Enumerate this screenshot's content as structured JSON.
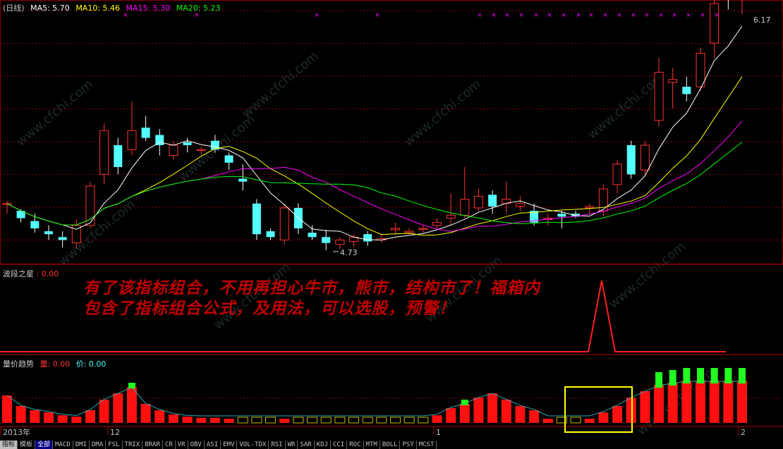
{
  "main_panel": {
    "period_label": "(日线)",
    "ma": [
      {
        "label": "MA5: 5.70",
        "color": "#ffffff"
      },
      {
        "label": "MA10: 5.46",
        "color": "#ffff00"
      },
      {
        "label": "MA15: 5.30",
        "color": "#ff00ff"
      },
      {
        "label": "MA20: 5.23",
        "color": "#00ff00"
      }
    ],
    "high_label": "6.17",
    "low_label": "4.73"
  },
  "indicator_panel": {
    "name": "波段之星",
    "value": ": 0.00",
    "promo_text": "有了该指标组合，不用再担心牛市，熊市，结构市了！福箱内包含了指标组合公式，及用法，可以选股，预警！"
  },
  "volume_panel": {
    "name": "量价趋势",
    "vol_label": "量: 0.00",
    "price_label": "价: 0.00"
  },
  "date_axis": {
    "labels": [
      "2013年",
      "12",
      "1",
      "2"
    ]
  },
  "tabs": [
    "指标",
    "模板",
    "全部",
    "MACD",
    "DMI",
    "DMA",
    "FSL",
    "TRIX",
    "BRAR",
    "CR",
    "VR",
    "OBV",
    "ASI",
    "EMV",
    "VOL-TDX",
    "RSI",
    "WR",
    "SAR",
    "KDJ",
    "CCI",
    "ROC",
    "MTM",
    "BOLL",
    "PSY",
    "MCST"
  ],
  "watermark": "www.cfchi.com",
  "colors": {
    "up": "#ff3232",
    "down": "#54ffff",
    "ma5": "#ffffff",
    "ma10": "#ffff00",
    "ma15": "#ff00ff",
    "ma20": "#00ff00",
    "grid": "#8b0000",
    "highlight": "#ffff00"
  },
  "chart_data": {
    "type": "candlestick",
    "ohlc": [
      [
        5.05,
        5.07,
        4.98,
        5.05
      ],
      [
        5.0,
        5.01,
        4.92,
        4.95
      ],
      [
        4.93,
        4.98,
        4.85,
        4.88
      ],
      [
        4.86,
        4.9,
        4.8,
        4.84
      ],
      [
        4.82,
        4.86,
        4.75,
        4.8
      ],
      [
        4.78,
        4.94,
        4.74,
        4.9
      ],
      [
        4.9,
        5.2,
        4.88,
        5.17
      ],
      [
        5.25,
        5.6,
        5.18,
        5.55
      ],
      [
        5.45,
        5.5,
        5.25,
        5.3
      ],
      [
        5.42,
        5.75,
        5.38,
        5.55
      ],
      [
        5.57,
        5.65,
        5.48,
        5.5
      ],
      [
        5.52,
        5.56,
        5.38,
        5.45
      ],
      [
        5.38,
        5.48,
        5.35,
        5.45
      ],
      [
        5.47,
        5.5,
        5.4,
        5.45
      ],
      [
        5.42,
        5.44,
        5.38,
        5.42
      ],
      [
        5.48,
        5.52,
        5.4,
        5.42
      ],
      [
        5.38,
        5.4,
        5.28,
        5.33
      ],
      [
        5.22,
        5.32,
        5.14,
        5.2
      ],
      [
        5.05,
        5.08,
        4.8,
        4.84
      ],
      [
        4.86,
        4.88,
        4.8,
        4.82
      ],
      [
        4.8,
        5.05,
        4.77,
        5.02
      ],
      [
        5.02,
        5.05,
        4.84,
        4.88
      ],
      [
        4.85,
        4.9,
        4.8,
        4.82
      ],
      [
        4.82,
        4.87,
        4.73,
        4.78
      ],
      [
        4.77,
        4.82,
        4.74,
        4.8
      ],
      [
        4.79,
        4.84,
        4.75,
        4.82
      ],
      [
        4.84,
        4.86,
        4.76,
        4.79
      ],
      [
        4.8,
        4.84,
        4.78,
        4.81
      ],
      [
        4.87,
        4.92,
        4.84,
        4.88
      ],
      [
        4.85,
        4.88,
        4.84,
        4.86
      ],
      [
        4.88,
        4.9,
        4.85,
        4.88
      ],
      [
        4.9,
        4.95,
        4.88,
        4.92
      ],
      [
        4.95,
        5.12,
        4.9,
        4.97
      ],
      [
        4.97,
        5.3,
        4.95,
        5.08
      ],
      [
        5.02,
        5.15,
        5.0,
        5.1
      ],
      [
        5.11,
        5.14,
        4.98,
        5.03
      ],
      [
        5.05,
        5.2,
        4.98,
        5.08
      ],
      [
        5.03,
        5.1,
        5.0,
        5.05
      ],
      [
        5.0,
        5.05,
        4.9,
        4.92
      ],
      [
        4.94,
        4.98,
        4.9,
        4.95
      ],
      [
        4.98,
        5.0,
        4.88,
        4.96
      ],
      [
        4.98,
        5.0,
        4.95,
        4.96
      ],
      [
        5.02,
        5.05,
        4.98,
        5.03
      ],
      [
        5.0,
        5.18,
        4.96,
        5.15
      ],
      [
        5.18,
        5.35,
        5.12,
        5.32
      ],
      [
        5.45,
        5.48,
        5.22,
        5.25
      ],
      [
        5.28,
        5.48,
        5.25,
        5.45
      ],
      [
        5.62,
        6.05,
        5.58,
        5.95
      ],
      [
        5.88,
        5.98,
        5.7,
        5.9
      ],
      [
        5.85,
        5.92,
        5.75,
        5.8
      ],
      [
        5.85,
        6.12,
        5.82,
        6.08
      ],
      [
        6.15,
        6.45,
        6.05,
        6.42
      ],
      [
        6.5,
        6.6,
        6.38,
        6.45
      ],
      [
        6.52,
        6.7,
        6.35,
        6.58
      ]
    ],
    "high": 6.17,
    "low": 4.73
  }
}
